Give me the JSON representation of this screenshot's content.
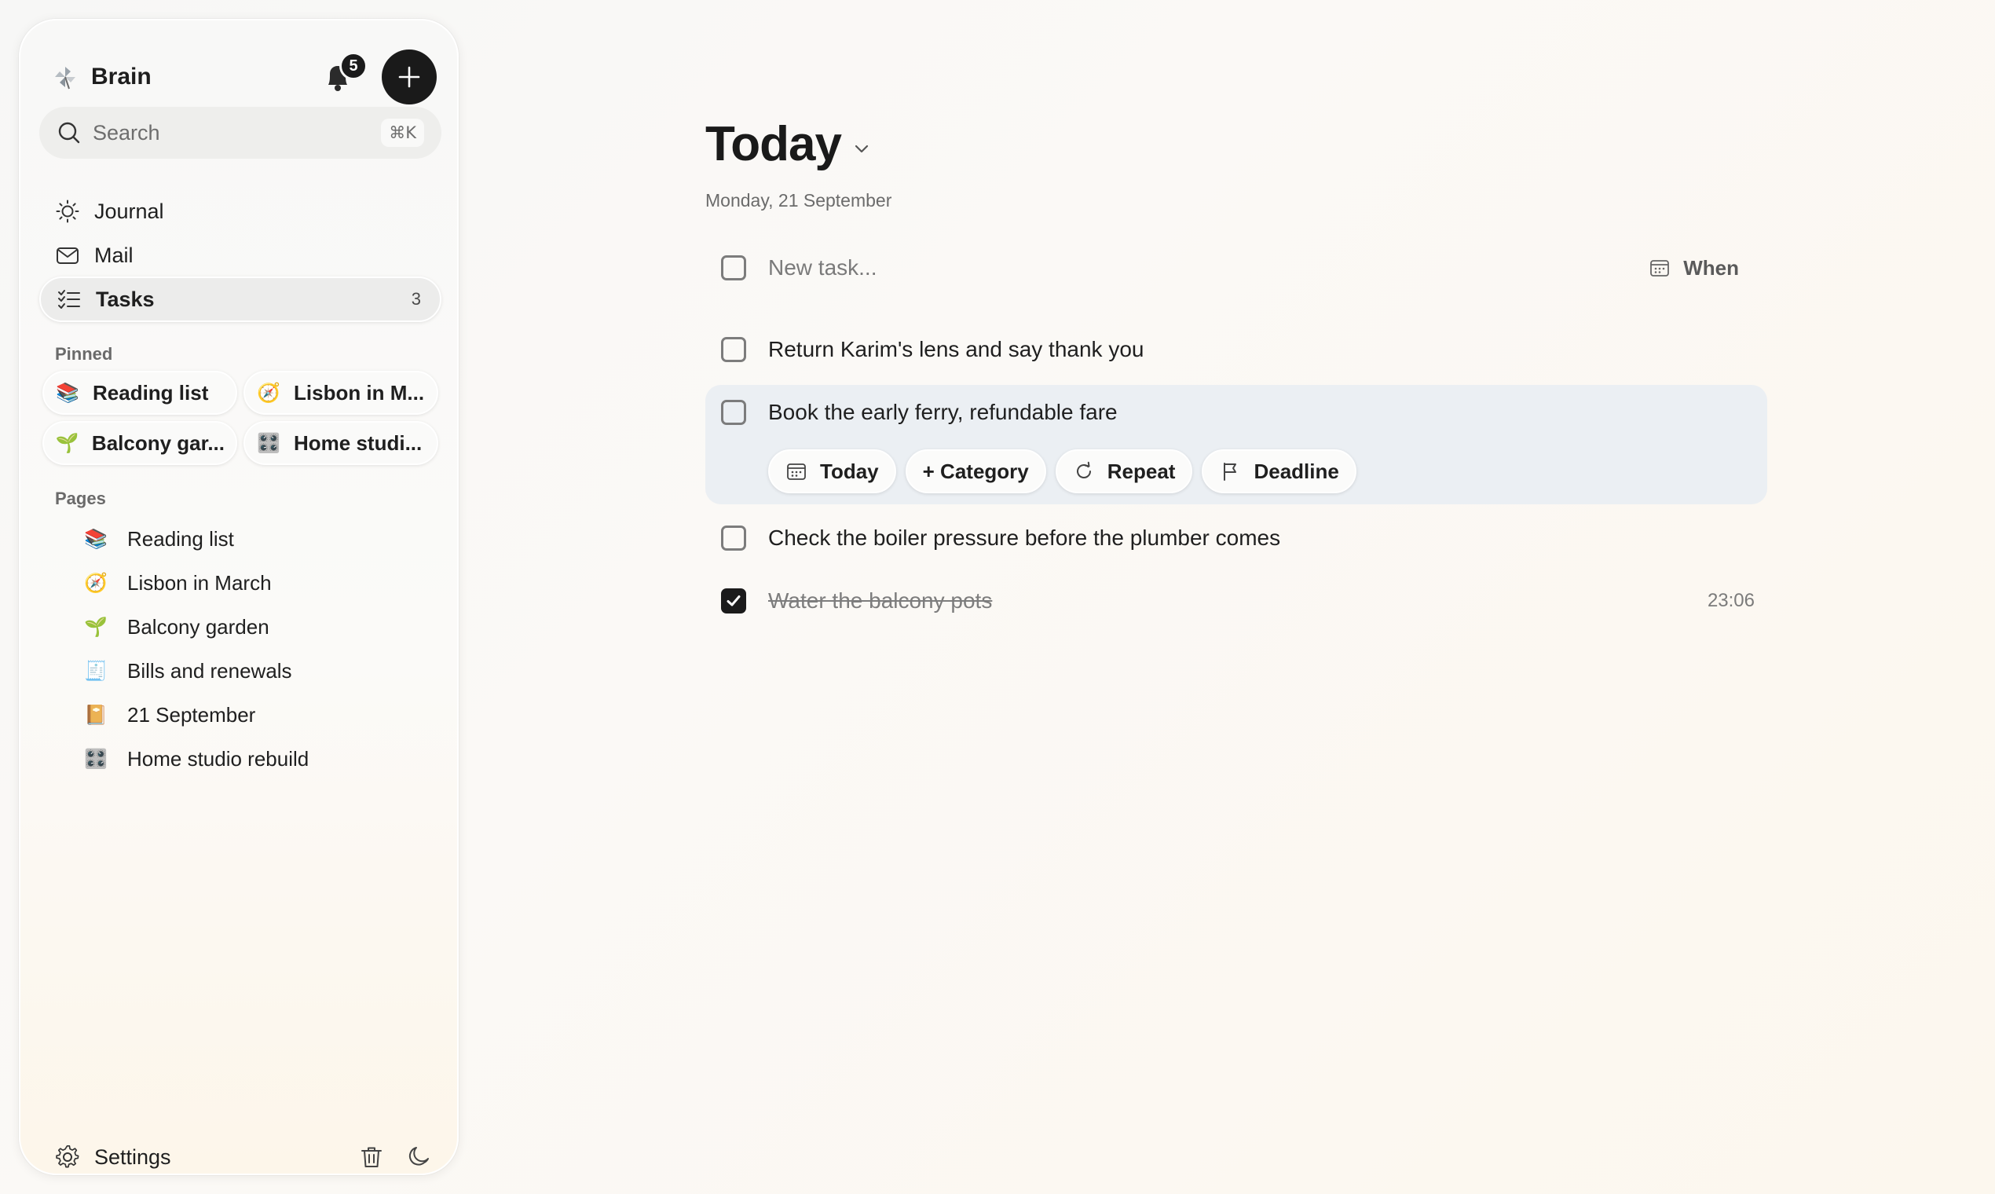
{
  "sidebar": {
    "brand": "Brain",
    "notifications": "5",
    "search": {
      "placeholder": "Search",
      "shortcut": "⌘K"
    },
    "nav": [
      {
        "label": "Journal",
        "icon": "sun-icon"
      },
      {
        "label": "Mail",
        "icon": "mail-icon"
      },
      {
        "label": "Tasks",
        "icon": "checklist-icon",
        "count": "3",
        "active": true
      }
    ],
    "pinned_label": "Pinned",
    "pinned": [
      {
        "label": "Reading list",
        "emoji": "📚"
      },
      {
        "label": "Lisbon in M...",
        "emoji": "🧭"
      },
      {
        "label": "Balcony gar...",
        "emoji": "🌱"
      },
      {
        "label": "Home studi...",
        "emoji": "🎛️"
      }
    ],
    "pages_label": "Pages",
    "pages": [
      {
        "label": "Reading list",
        "emoji": "📚"
      },
      {
        "label": "Lisbon in March",
        "emoji": "🧭"
      },
      {
        "label": "Balcony garden",
        "emoji": "🌱"
      },
      {
        "label": "Bills and renewals",
        "emoji": "🧾"
      },
      {
        "label": "21 September",
        "emoji": "📔"
      },
      {
        "label": "Home studio rebuild",
        "emoji": "🎛️"
      }
    ],
    "settings_label": "Settings"
  },
  "main": {
    "title": "Today",
    "date": "Monday, 21 September",
    "new_task": {
      "placeholder": "New task...",
      "when_label": "When"
    },
    "tasks": [
      {
        "text": "Return Karim's lens and say thank you",
        "done": false
      },
      {
        "text": "Book the early ferry, refundable fare",
        "done": false,
        "selected": true
      },
      {
        "text": "Check the boiler pressure before the plumber comes",
        "done": false
      },
      {
        "text": "Water the balcony pots",
        "done": true,
        "time": "23:06"
      }
    ],
    "chips": {
      "today": "Today",
      "category": "+ Category",
      "repeat": "Repeat",
      "deadline": "Deadline"
    }
  },
  "colors": {
    "accent_dark": "#1a1a1a",
    "selected_row_bg": "#ebeff3",
    "sidebar_bg": "#f8f8f7"
  }
}
